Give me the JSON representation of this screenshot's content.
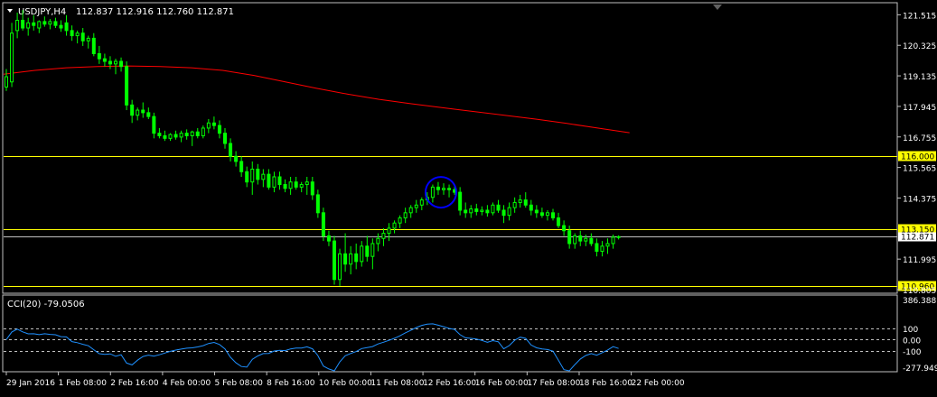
{
  "header": {
    "symbol": "USDJPY,H4",
    "ohlc": "112.837 112.916 112.760 112.871"
  },
  "colors": {
    "background": "#000000",
    "frame": "#c0c0c0",
    "bull_candle": "#ffffff",
    "bear_candle": "#00ff00",
    "moving_average": "#ff0000",
    "level_line": "#ffff00",
    "cci_line": "#1e90ff",
    "cci_levels": "#c0c0c0",
    "marker_circle": "#0000ff",
    "label_text": "#ffffff"
  },
  "chart_data": {
    "type": "candlestick",
    "y_axis_ticks": [
      "121.515",
      "120.325",
      "119.135",
      "117.945",
      "116.755",
      "115.565",
      "114.375",
      "111.995",
      "110.805"
    ],
    "x_axis_labels": [
      "29 Jan 2016",
      "1 Feb 08:00",
      "2 Feb 16:00",
      "4 Feb 00:00",
      "5 Feb 08:00",
      "8 Feb 16:00",
      "10 Feb 00:00",
      "11 Feb 08:00",
      "12 Feb 16:00",
      "16 Feb 00:00",
      "17 Feb 08:00",
      "18 Feb 16:00",
      "22 Feb 00:00"
    ],
    "ylim": [
      110.7,
      121.95
    ],
    "candles": [
      {
        "o": 118.7,
        "h": 119.4,
        "l": 118.55,
        "c": 119.1
      },
      {
        "o": 118.9,
        "h": 121.2,
        "l": 118.7,
        "c": 120.8
      },
      {
        "o": 120.9,
        "h": 121.6,
        "l": 120.6,
        "c": 121.3
      },
      {
        "o": 121.3,
        "h": 121.7,
        "l": 120.9,
        "c": 121.0
      },
      {
        "o": 121.0,
        "h": 121.4,
        "l": 120.7,
        "c": 121.2
      },
      {
        "o": 121.2,
        "h": 121.5,
        "l": 120.9,
        "c": 121.1
      },
      {
        "o": 121.0,
        "h": 121.3,
        "l": 120.8,
        "c": 121.25
      },
      {
        "o": 121.25,
        "h": 121.45,
        "l": 121.05,
        "c": 121.15
      },
      {
        "o": 121.15,
        "h": 121.35,
        "l": 120.95,
        "c": 121.25
      },
      {
        "o": 121.25,
        "h": 121.4,
        "l": 121.0,
        "c": 121.1
      },
      {
        "o": 121.1,
        "h": 121.3,
        "l": 120.85,
        "c": 121.0
      },
      {
        "o": 121.2,
        "h": 121.5,
        "l": 120.7,
        "c": 120.9
      },
      {
        "o": 120.9,
        "h": 121.1,
        "l": 120.5,
        "c": 120.7
      },
      {
        "o": 120.7,
        "h": 120.9,
        "l": 120.4,
        "c": 120.8
      },
      {
        "o": 120.8,
        "h": 121.0,
        "l": 120.3,
        "c": 120.5
      },
      {
        "o": 120.5,
        "h": 120.7,
        "l": 120.2,
        "c": 120.6
      },
      {
        "o": 120.6,
        "h": 120.8,
        "l": 119.9,
        "c": 120.0
      },
      {
        "o": 120.0,
        "h": 120.3,
        "l": 119.6,
        "c": 119.8
      },
      {
        "o": 119.8,
        "h": 120.0,
        "l": 119.5,
        "c": 119.7
      },
      {
        "o": 119.7,
        "h": 119.9,
        "l": 119.4,
        "c": 119.6
      },
      {
        "o": 119.6,
        "h": 119.8,
        "l": 119.2,
        "c": 119.7
      },
      {
        "o": 119.7,
        "h": 119.85,
        "l": 119.3,
        "c": 119.5
      },
      {
        "o": 119.5,
        "h": 119.7,
        "l": 117.8,
        "c": 118.0
      },
      {
        "o": 118.0,
        "h": 118.2,
        "l": 117.3,
        "c": 117.6
      },
      {
        "o": 117.6,
        "h": 117.9,
        "l": 117.4,
        "c": 117.8
      },
      {
        "o": 117.8,
        "h": 118.1,
        "l": 117.5,
        "c": 117.7
      },
      {
        "o": 117.7,
        "h": 117.9,
        "l": 117.45,
        "c": 117.55
      },
      {
        "o": 117.55,
        "h": 117.7,
        "l": 116.7,
        "c": 116.9
      },
      {
        "o": 116.9,
        "h": 117.1,
        "l": 116.7,
        "c": 116.8
      },
      {
        "o": 116.8,
        "h": 117.0,
        "l": 116.6,
        "c": 116.7
      },
      {
        "o": 116.7,
        "h": 116.9,
        "l": 116.6,
        "c": 116.85
      },
      {
        "o": 116.85,
        "h": 117.0,
        "l": 116.65,
        "c": 116.75
      },
      {
        "o": 116.75,
        "h": 117.0,
        "l": 116.55,
        "c": 116.9
      },
      {
        "o": 116.9,
        "h": 117.05,
        "l": 116.65,
        "c": 116.8
      },
      {
        "o": 116.8,
        "h": 117.0,
        "l": 116.4,
        "c": 116.95
      },
      {
        "o": 116.95,
        "h": 117.1,
        "l": 116.7,
        "c": 116.8
      },
      {
        "o": 116.8,
        "h": 117.2,
        "l": 116.7,
        "c": 117.1
      },
      {
        "o": 117.1,
        "h": 117.45,
        "l": 116.9,
        "c": 117.3
      },
      {
        "o": 117.3,
        "h": 117.55,
        "l": 117.05,
        "c": 117.2
      },
      {
        "o": 117.2,
        "h": 117.4,
        "l": 116.7,
        "c": 116.9
      },
      {
        "o": 116.9,
        "h": 117.1,
        "l": 116.3,
        "c": 116.5
      },
      {
        "o": 116.5,
        "h": 116.7,
        "l": 115.8,
        "c": 116.0
      },
      {
        "o": 116.0,
        "h": 116.2,
        "l": 115.6,
        "c": 115.8
      },
      {
        "o": 115.8,
        "h": 116.0,
        "l": 115.2,
        "c": 115.4
      },
      {
        "o": 115.4,
        "h": 115.6,
        "l": 114.8,
        "c": 115.0
      },
      {
        "o": 115.0,
        "h": 115.8,
        "l": 114.5,
        "c": 115.5
      },
      {
        "o": 115.5,
        "h": 115.7,
        "l": 114.9,
        "c": 115.1
      },
      {
        "o": 115.1,
        "h": 115.5,
        "l": 114.8,
        "c": 115.3
      },
      {
        "o": 115.3,
        "h": 115.5,
        "l": 114.7,
        "c": 114.8
      },
      {
        "o": 114.8,
        "h": 115.4,
        "l": 114.6,
        "c": 115.2
      },
      {
        "o": 115.2,
        "h": 115.4,
        "l": 114.7,
        "c": 114.9
      },
      {
        "o": 114.9,
        "h": 115.1,
        "l": 114.6,
        "c": 114.75
      },
      {
        "o": 114.75,
        "h": 115.2,
        "l": 114.5,
        "c": 115.0
      },
      {
        "o": 115.0,
        "h": 115.2,
        "l": 114.7,
        "c": 114.8
      },
      {
        "o": 114.8,
        "h": 115.0,
        "l": 114.6,
        "c": 114.9
      },
      {
        "o": 114.9,
        "h": 115.2,
        "l": 114.5,
        "c": 115.0
      },
      {
        "o": 115.0,
        "h": 115.2,
        "l": 114.3,
        "c": 114.5
      },
      {
        "o": 114.5,
        "h": 114.7,
        "l": 113.6,
        "c": 113.8
      },
      {
        "o": 113.8,
        "h": 114.0,
        "l": 112.7,
        "c": 112.9
      },
      {
        "o": 112.9,
        "h": 113.1,
        "l": 112.5,
        "c": 112.7
      },
      {
        "o": 112.7,
        "h": 112.9,
        "l": 111.0,
        "c": 111.2
      },
      {
        "o": 111.2,
        "h": 112.4,
        "l": 110.95,
        "c": 112.2
      },
      {
        "o": 112.2,
        "h": 113.0,
        "l": 111.5,
        "c": 111.8
      },
      {
        "o": 111.8,
        "h": 112.5,
        "l": 111.4,
        "c": 112.2
      },
      {
        "o": 112.2,
        "h": 112.6,
        "l": 111.6,
        "c": 111.9
      },
      {
        "o": 111.9,
        "h": 112.7,
        "l": 111.7,
        "c": 112.5
      },
      {
        "o": 112.5,
        "h": 112.9,
        "l": 111.9,
        "c": 112.1
      },
      {
        "o": 112.1,
        "h": 112.8,
        "l": 111.6,
        "c": 112.6
      },
      {
        "o": 112.6,
        "h": 113.0,
        "l": 112.3,
        "c": 112.8
      },
      {
        "o": 112.8,
        "h": 113.2,
        "l": 112.5,
        "c": 113.0
      },
      {
        "o": 113.0,
        "h": 113.4,
        "l": 112.7,
        "c": 113.2
      },
      {
        "o": 113.2,
        "h": 113.5,
        "l": 113.0,
        "c": 113.4
      },
      {
        "o": 113.4,
        "h": 113.7,
        "l": 113.2,
        "c": 113.6
      },
      {
        "o": 113.6,
        "h": 114.0,
        "l": 113.4,
        "c": 113.8
      },
      {
        "o": 113.8,
        "h": 114.1,
        "l": 113.6,
        "c": 114.0
      },
      {
        "o": 114.0,
        "h": 114.3,
        "l": 113.8,
        "c": 114.1
      },
      {
        "o": 114.1,
        "h": 114.4,
        "l": 113.9,
        "c": 114.3
      },
      {
        "o": 114.3,
        "h": 114.6,
        "l": 114.1,
        "c": 114.4
      },
      {
        "o": 114.4,
        "h": 114.9,
        "l": 114.2,
        "c": 114.8
      },
      {
        "o": 114.8,
        "h": 115.0,
        "l": 114.5,
        "c": 114.7
      },
      {
        "o": 114.7,
        "h": 114.95,
        "l": 114.5,
        "c": 114.75
      },
      {
        "o": 114.75,
        "h": 114.9,
        "l": 114.4,
        "c": 114.7
      },
      {
        "o": 114.7,
        "h": 114.9,
        "l": 114.5,
        "c": 114.6
      },
      {
        "o": 114.6,
        "h": 114.8,
        "l": 113.7,
        "c": 113.9
      },
      {
        "o": 113.9,
        "h": 114.2,
        "l": 113.6,
        "c": 113.8
      },
      {
        "o": 113.8,
        "h": 114.1,
        "l": 113.6,
        "c": 113.95
      },
      {
        "o": 113.95,
        "h": 114.15,
        "l": 113.7,
        "c": 113.85
      },
      {
        "o": 113.85,
        "h": 114.05,
        "l": 113.7,
        "c": 113.9
      },
      {
        "o": 113.9,
        "h": 114.1,
        "l": 113.65,
        "c": 113.8
      },
      {
        "o": 113.8,
        "h": 114.2,
        "l": 113.7,
        "c": 114.1
      },
      {
        "o": 114.1,
        "h": 114.3,
        "l": 113.8,
        "c": 113.9
      },
      {
        "o": 113.9,
        "h": 114.1,
        "l": 113.4,
        "c": 113.7
      },
      {
        "o": 113.7,
        "h": 114.2,
        "l": 113.5,
        "c": 114.0
      },
      {
        "o": 114.0,
        "h": 114.4,
        "l": 113.8,
        "c": 114.2
      },
      {
        "o": 114.2,
        "h": 114.5,
        "l": 114.0,
        "c": 114.3
      },
      {
        "o": 114.3,
        "h": 114.6,
        "l": 114.0,
        "c": 114.1
      },
      {
        "o": 114.1,
        "h": 114.3,
        "l": 113.7,
        "c": 113.9
      },
      {
        "o": 113.9,
        "h": 114.1,
        "l": 113.6,
        "c": 113.8
      },
      {
        "o": 113.8,
        "h": 114.0,
        "l": 113.6,
        "c": 113.7
      },
      {
        "o": 113.7,
        "h": 113.9,
        "l": 113.5,
        "c": 113.8
      },
      {
        "o": 113.8,
        "h": 113.95,
        "l": 113.5,
        "c": 113.6
      },
      {
        "o": 113.6,
        "h": 113.8,
        "l": 113.2,
        "c": 113.3
      },
      {
        "o": 113.3,
        "h": 113.5,
        "l": 112.9,
        "c": 113.1
      },
      {
        "o": 113.1,
        "h": 113.3,
        "l": 112.4,
        "c": 112.6
      },
      {
        "o": 112.6,
        "h": 113.0,
        "l": 112.4,
        "c": 112.9
      },
      {
        "o": 112.9,
        "h": 113.1,
        "l": 112.5,
        "c": 112.7
      },
      {
        "o": 112.7,
        "h": 112.95,
        "l": 112.5,
        "c": 112.8
      },
      {
        "o": 112.8,
        "h": 113.0,
        "l": 112.5,
        "c": 112.6
      },
      {
        "o": 112.6,
        "h": 112.8,
        "l": 112.1,
        "c": 112.3
      },
      {
        "o": 112.3,
        "h": 112.7,
        "l": 112.1,
        "c": 112.5
      },
      {
        "o": 112.5,
        "h": 112.8,
        "l": 112.2,
        "c": 112.6
      },
      {
        "o": 112.6,
        "h": 112.95,
        "l": 112.4,
        "c": 112.85
      },
      {
        "o": 112.84,
        "h": 112.92,
        "l": 112.76,
        "c": 112.87
      }
    ],
    "moving_average": [
      119.2,
      119.35,
      119.45,
      119.5,
      119.52,
      119.5,
      119.45,
      119.35,
      119.15,
      118.9,
      118.65,
      118.42,
      118.22,
      118.05,
      117.9,
      117.75,
      117.6,
      117.45,
      117.28,
      117.1,
      116.92
    ],
    "levels": [
      {
        "value": 116.0,
        "label": "116.000"
      },
      {
        "value": 113.15,
        "label": "113.150"
      },
      {
        "value": 110.96,
        "label": "110.960"
      }
    ],
    "current_price": {
      "value": 112.871,
      "label": "112.871"
    },
    "marker_circle_bars": [
      78,
      81
    ],
    "cci": {
      "label": "CCI(20) -79.0506",
      "period": 20,
      "last_value": -79.0506,
      "ylim": [
        -277.9493,
        386.3881
      ],
      "axis_ticks": [
        "386.3881",
        "100",
        "0.00",
        "-100",
        "-277.9493"
      ],
      "levels": [
        100,
        0,
        -100
      ]
    }
  }
}
